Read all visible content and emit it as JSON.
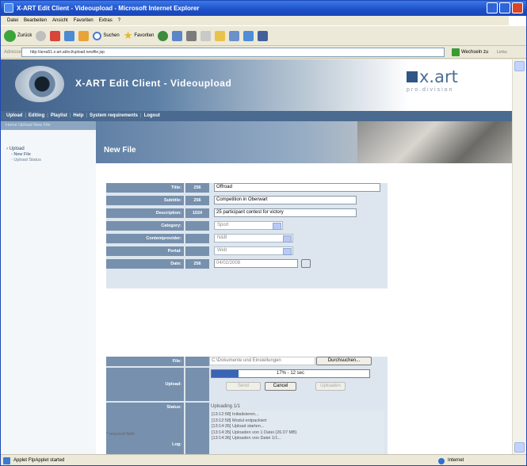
{
  "window": {
    "title": "X-ART Edit Client - Videoupload - Microsoft Internet Explorer"
  },
  "menu": [
    "Datei",
    "Bearbeiten",
    "Ansicht",
    "Favoriten",
    "Extras",
    "?"
  ],
  "toolbar": {
    "back": "Zurück",
    "search": "Suchen",
    "favorites": "Favoriten"
  },
  "address": {
    "label": "Adresse",
    "url": "http://area51.x-art.at/ecl/upload.newfile.jsp",
    "go": "Wechseln zu",
    "links": "Links"
  },
  "app": {
    "title": "X-ART Edit Client - Videoupload",
    "logo": "x.art",
    "division": "pro.division"
  },
  "nav": [
    "Upload",
    "Editing",
    "Playlist",
    "Help",
    "System requirements",
    "Logout"
  ],
  "crumb": "Home   Upload   New File",
  "sidebar": {
    "section": "Upload",
    "items": [
      "New File",
      "Upload Status"
    ]
  },
  "page_title": "New File",
  "form": {
    "title": {
      "label": "Title:",
      "count": "256",
      "value": "Offroad"
    },
    "subtitle": {
      "label": "Subtitle:",
      "count": "256",
      "value": "Competition in Oberwart"
    },
    "description": {
      "label": "Description:",
      "count": "1024",
      "value": "25 participant contest for victory"
    },
    "category": {
      "label": "Category:",
      "value": "Sport"
    },
    "contentprovider": {
      "label": "Contentprovider:",
      "value": "N&B"
    },
    "portal": {
      "label": "Portal:",
      "value": "Web"
    },
    "date": {
      "label": "Date:",
      "count": "256",
      "value": "04/02/2008"
    }
  },
  "upload": {
    "file_label": "File:",
    "file_value": "C:\\Dokumente und Einstellungen",
    "browse": "Durchsuchen...",
    "upload_label": "Upload:",
    "progress_text": "17% - 12 sec",
    "progress_fraction": 0.17,
    "send": "Send",
    "cancel": "Cancel",
    "upload_btn": "Uploaden",
    "status_label": "Status:",
    "status_value": "Uploading 1/1",
    "log_label": "Log:",
    "log": [
      "[13:12:58] Initialisieren...",
      "[13:12:58] Modul entpackiert",
      "[13:14:35] Upload starten...",
      "[13:14:35] Uploaden von 1 Datei (26.07 MB)",
      "[13:14:36] Uploaden von Datei 1/1..."
    ]
  },
  "required_note": "* required field",
  "status": {
    "text": "Applet FtpApplet started",
    "zone": "Internet"
  }
}
